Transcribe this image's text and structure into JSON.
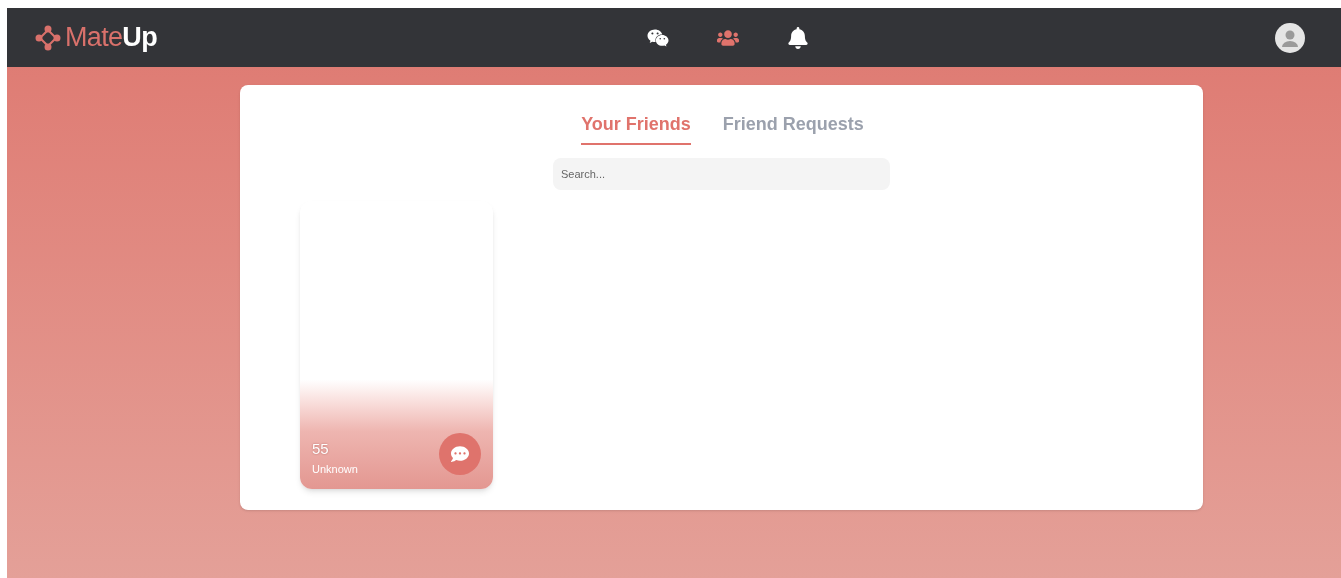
{
  "header": {
    "logo": "Mate**Up**",
    "nav": [
      {
        "kind": "chat",
        "selected": false
      },
      {
        "kind": "friends",
        "selected": true
      },
      {
        "kind": "notifications",
        "selected": false
      }
    ]
  },
  "tabs": [
    {
      "label": "Your Friends",
      "selected": true
    },
    {
      "label": "Friend Requests",
      "selected": false
    }
  ],
  "search": {
    "placeholder": "Search..."
  },
  "friends": [
    {
      "age": "55",
      "location": "Unknown"
    }
  ]
}
